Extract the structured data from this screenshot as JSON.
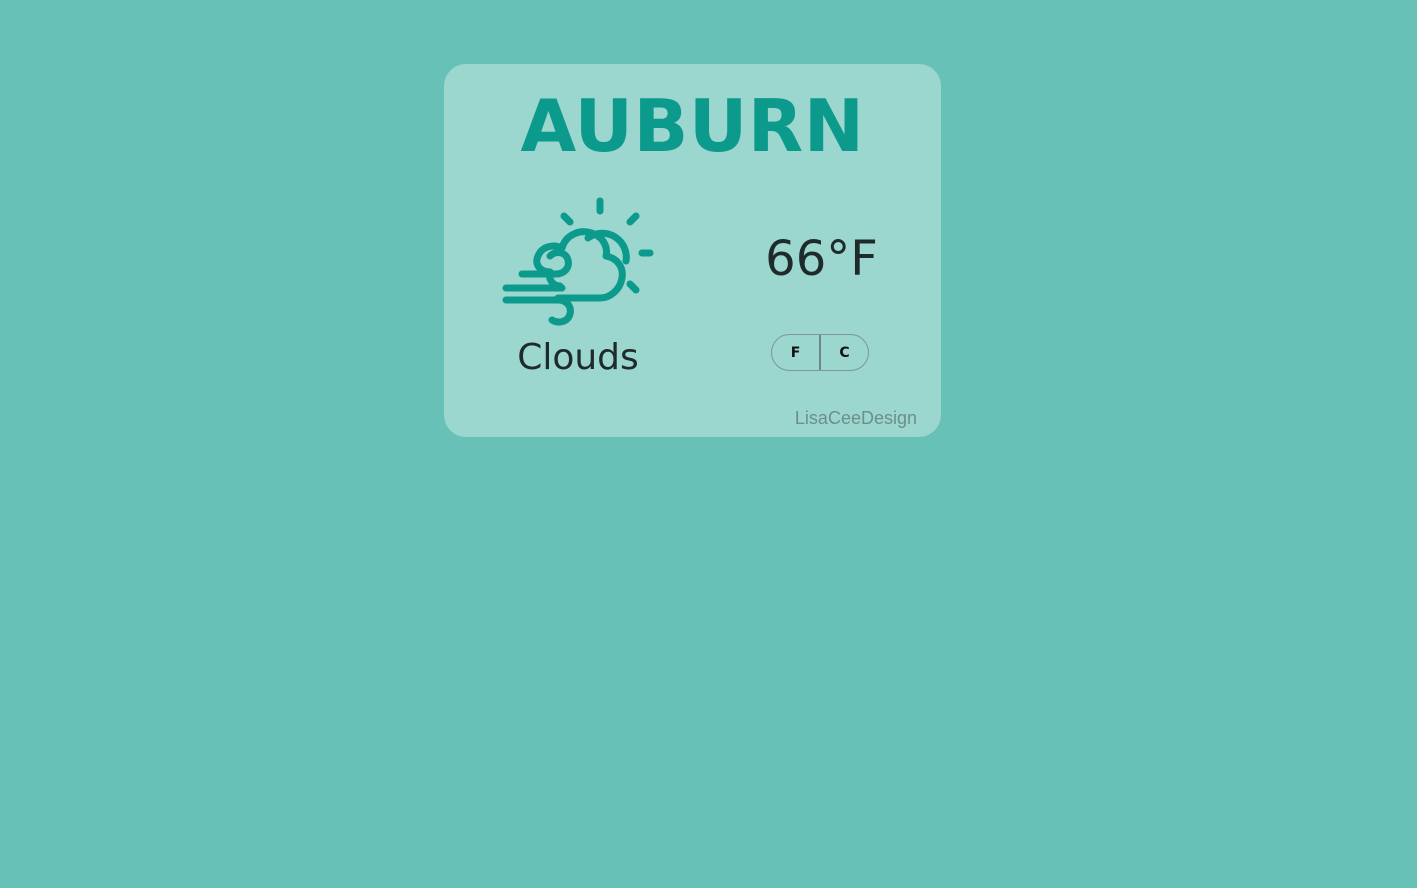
{
  "card": {
    "city": "AUBURN",
    "weather": {
      "icon": "cloudy-windy-sun-icon",
      "description": "Clouds"
    },
    "temperature": "66°F",
    "unit_toggle": {
      "fahrenheit_label": "F",
      "celsius_label": "C"
    },
    "credit": "LisaCeeDesign"
  },
  "colors": {
    "background": "#67c1b7",
    "card": "#9bd6cf",
    "accent": "#0b9a8c",
    "text": "#1f2a2a"
  }
}
